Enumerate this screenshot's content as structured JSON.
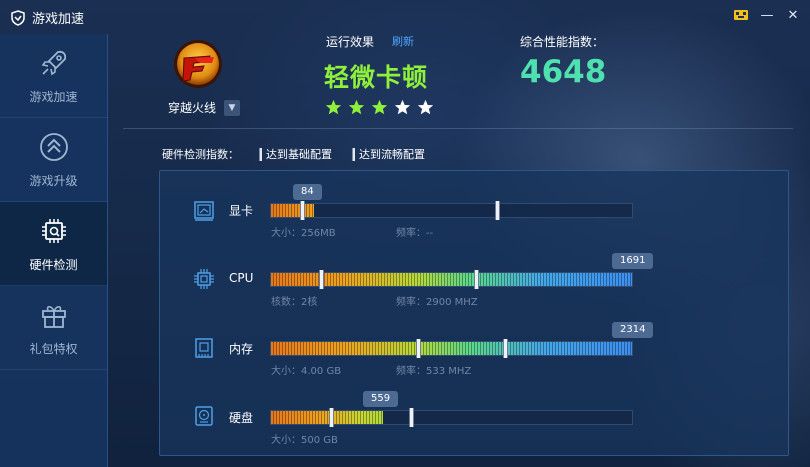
{
  "window": {
    "title": "游戏加速",
    "buttons": {
      "skin": "skin-icon",
      "minimize": "—",
      "close": "✕"
    }
  },
  "sidebar": {
    "items": [
      {
        "label": "游戏加速",
        "icon": "rocket-icon",
        "active": false
      },
      {
        "label": "游戏升级",
        "icon": "upgrade-icon",
        "active": false
      },
      {
        "label": "硬件检测",
        "icon": "chip-icon",
        "active": true
      },
      {
        "label": "礼包特权",
        "icon": "gift-icon",
        "active": false
      }
    ]
  },
  "game": {
    "name": "穿越火线",
    "logo_icon": "crossfire-logo",
    "dropdown_icon": "chevron-down-icon"
  },
  "effect": {
    "label": "运行效果",
    "refresh": "刷新",
    "value": "轻微卡顿",
    "stars": 5,
    "star_color": "#8ef03b"
  },
  "score": {
    "label": "综合性能指数：",
    "value": "4648"
  },
  "legend": {
    "title": "硬件检测指数：",
    "basic": "达到基础配置",
    "smooth": "达到流畅配置"
  },
  "hardware": [
    {
      "key": "gpu",
      "label": "显卡",
      "icon": "graphics-card-icon",
      "score": "84",
      "fill_fraction": 0.12,
      "basic_marker": 0.09,
      "smooth_marker": 0.63,
      "info1": "大小：256MB",
      "info2": "频率：--"
    },
    {
      "key": "cpu",
      "label": "CPU",
      "icon": "cpu-icon",
      "score": "1691",
      "fill_fraction": 1.0,
      "basic_marker": 0.14,
      "smooth_marker": 0.57,
      "info1": "核数：2核",
      "info2": "频率：2900 MHZ"
    },
    {
      "key": "memory",
      "label": "内存",
      "icon": "memory-icon",
      "score": "2314",
      "fill_fraction": 1.0,
      "basic_marker": 0.41,
      "smooth_marker": 0.65,
      "info1": "大小：4.00 GB",
      "info2": "频率：533 MHZ"
    },
    {
      "key": "disk",
      "label": "硬盘",
      "icon": "hard-disk-icon",
      "score": "559",
      "fill_fraction": 0.31,
      "basic_marker": 0.17,
      "smooth_marker": 0.39,
      "info1": "大小：500 GB",
      "info2": ""
    }
  ]
}
